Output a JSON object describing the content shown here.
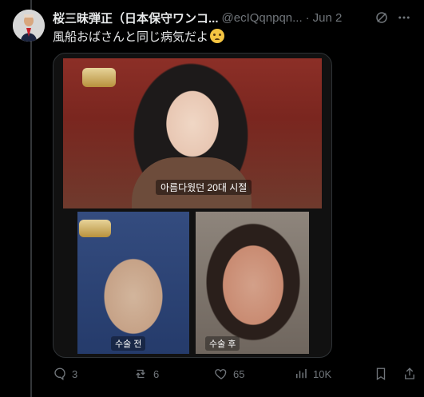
{
  "tweet": {
    "display_name": "桜三昧弾正（日本保守ワンコ...",
    "handle": "@ecIQqnpqn...",
    "date": "Jun 2",
    "text": "風船おばさんと同じ病気だよ"
  },
  "media": {
    "top_caption": "아름다웠던 20대 시절",
    "left_caption": "수술 전",
    "right_caption": "수술 후"
  },
  "actions": {
    "reply_count": "3",
    "retweet_count": "6",
    "like_count": "65",
    "view_count": "10K"
  },
  "colors": {
    "background": "#000000",
    "primary_text": "#e7e9ea",
    "secondary_text": "#71767b",
    "border": "#2f3336"
  }
}
